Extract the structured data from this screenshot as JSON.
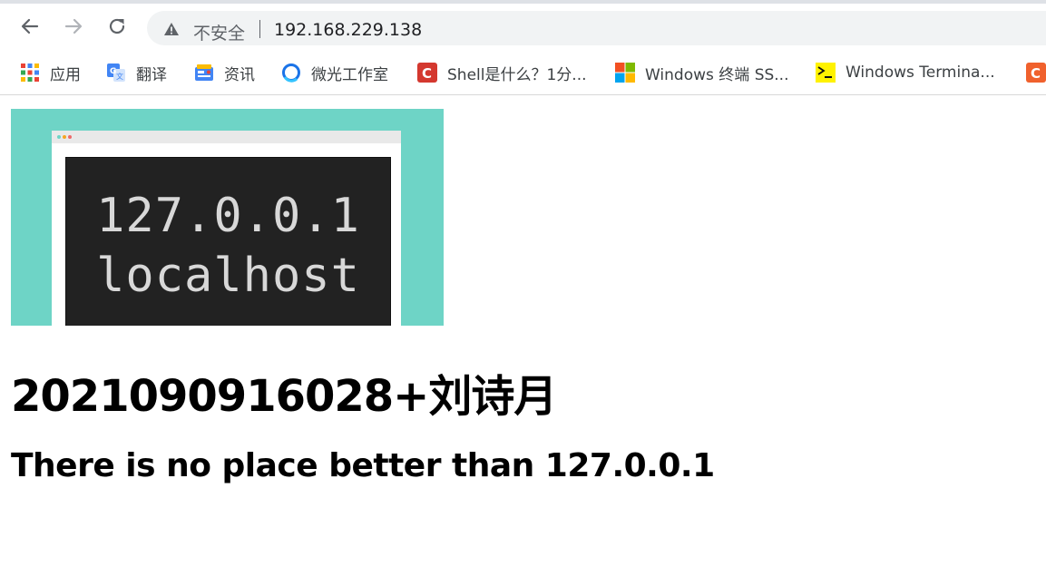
{
  "browser": {
    "security_label": "不安全",
    "url": "192.168.229.138",
    "icons": {
      "back": "arrow-left-icon",
      "forward": "arrow-right-icon",
      "reload": "reload-icon",
      "warning": "warning-triangle-icon"
    },
    "bookmarks": [
      {
        "label": "应用",
        "icon": "apps-grid-icon"
      },
      {
        "label": "翻译",
        "icon": "google-translate-icon"
      },
      {
        "label": "资讯",
        "icon": "news-icon"
      },
      {
        "label": "微光工作室",
        "icon": "ring-icon"
      },
      {
        "label": "Shell是什么？1分...",
        "icon": "csdn-icon"
      },
      {
        "label": "Windows 终端 SS...",
        "icon": "microsoft-icon"
      },
      {
        "label": "Windows Termina...",
        "icon": "terminal-icon"
      },
      {
        "label": "",
        "icon": "csdn-icon"
      }
    ]
  },
  "page": {
    "image_line1": "127.0.0.1",
    "image_line2": "localhost",
    "heading": "2021090916028+刘诗月",
    "subheading": "There is no place better than 127.0.0.1"
  },
  "colors": {
    "hero_bg": "#6ed4c6",
    "screen_bg": "#222222",
    "csdn_red": "#d4382f"
  }
}
